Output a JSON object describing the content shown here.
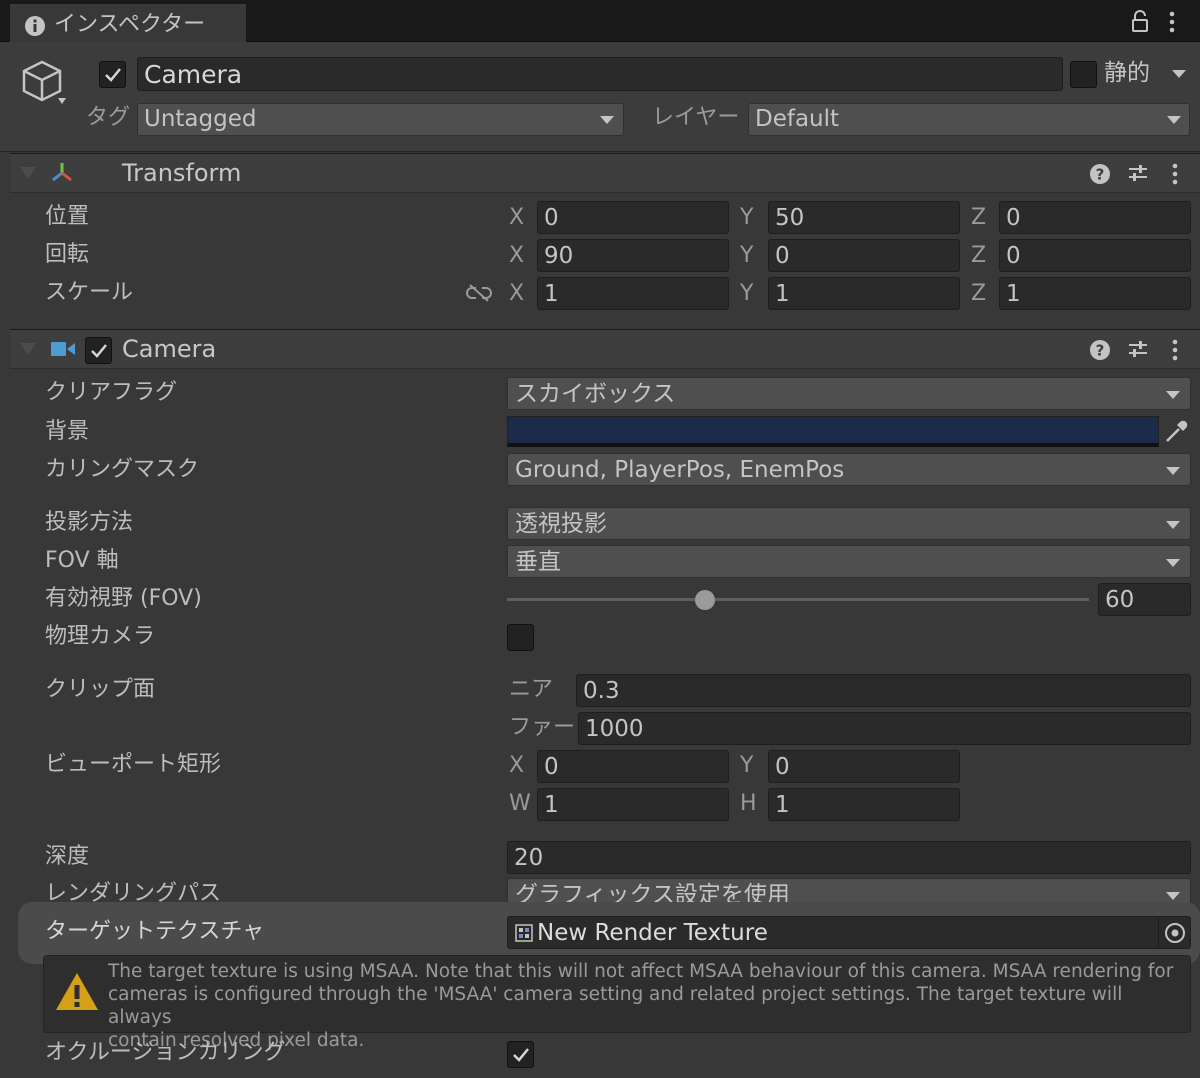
{
  "tab": {
    "title": "インスペクター"
  },
  "gameobject": {
    "name": "Camera",
    "static_label": "静的",
    "tag_label": "タグ",
    "tag_value": "Untagged",
    "layer_label": "レイヤー",
    "layer_value": "Default"
  },
  "transform": {
    "title": "Transform",
    "position": {
      "label": "位置",
      "x": "0",
      "y": "50",
      "z": "0"
    },
    "rotation": {
      "label": "回転",
      "x": "90",
      "y": "0",
      "z": "0"
    },
    "scale": {
      "label": "スケール",
      "x": "1",
      "y": "1",
      "z": "1"
    }
  },
  "axes": {
    "x": "X",
    "y": "Y",
    "z": "Z",
    "w": "W",
    "h": "H"
  },
  "camera": {
    "title": "Camera",
    "clear_flags": {
      "label": "クリアフラグ",
      "value": "スカイボックス"
    },
    "background": {
      "label": "背景",
      "color": "#1c2b4a"
    },
    "culling_mask": {
      "label": "カリングマスク",
      "value": "Ground, PlayerPos, EnemPos"
    },
    "projection": {
      "label": "投影方法",
      "value": "透視投影"
    },
    "fov_axis": {
      "label": "FOV 軸",
      "value": "垂直"
    },
    "fov": {
      "label": "有効視野 (FOV)",
      "value": "60",
      "slider_fraction": 0.34
    },
    "physical_camera": {
      "label": "物理カメラ"
    },
    "clipping": {
      "label": "クリップ面",
      "near_label": "ニア",
      "near": "0.3",
      "far_label": "ファー",
      "far": "1000"
    },
    "viewport": {
      "label": "ビューポート矩形",
      "x": "0",
      "y": "0",
      "w": "1",
      "h": "1"
    },
    "depth": {
      "label": "深度",
      "value": "20"
    },
    "rendering_path": {
      "label": "レンダリングパス",
      "value": "グラフィックス設定を使用"
    },
    "target_texture": {
      "label": "ターゲットテクスチャ",
      "value": "New Render Texture"
    },
    "msaa_warning": {
      "line1": "The target texture is using MSAA. Note that this will not affect MSAA behaviour of this camera. MSAA rendering for",
      "line2": "cameras is configured through the 'MSAA' camera setting and related project settings. The target texture will always",
      "line3": "contain resolved pixel data."
    },
    "occlusion_culling": {
      "label": "オクルージョンカリング"
    }
  },
  "colors": {
    "accent": "#4a90d9",
    "warning": "#d4a017"
  }
}
